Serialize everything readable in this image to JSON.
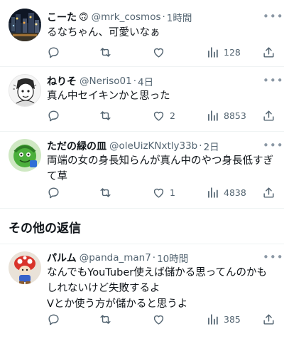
{
  "tweets": [
    {
      "name": "こーた",
      "emoji": "🙃",
      "handle": "@mrk_cosmos",
      "separator": "·",
      "time": "1時間",
      "lines": [
        "るなちゃん、可愛いなぁ"
      ],
      "likes": "",
      "views": "128",
      "avatar_icon": "night-city-avatar"
    },
    {
      "name": "ねりそ",
      "handle": "@Neriso01",
      "separator": "·",
      "time": "4日",
      "lines": [
        "真ん中セイキンかと思った"
      ],
      "likes": "2",
      "views": "8853",
      "avatar_icon": "manga-character-avatar"
    },
    {
      "name": "ただの緑の皿",
      "handle": "@oleUizKNxtly33b",
      "separator": "·",
      "time": "2日",
      "lines": [
        "両端の女の身長知らんが真ん中のやつ身長低すぎ",
        "て草"
      ],
      "likes": "1",
      "views": "4838",
      "avatar_icon": "green-character-avatar"
    }
  ],
  "section_title": "その他の返信",
  "more_tweets": [
    {
      "name": "パルム",
      "handle": "@panda_man7",
      "separator": "·",
      "time": "10時間",
      "lines": [
        "なんでもYouTuber使えば儲かる思ってんのかも",
        "しれないけど失敗するよ",
        "Vとか使う方が儲かると思うよ"
      ],
      "likes": "",
      "views": "385",
      "avatar_icon": "mushroom-figure-avatar"
    }
  ],
  "icons": {
    "more": "more-icon",
    "reply": "reply-icon",
    "retweet": "retweet-icon",
    "like": "heart-icon",
    "views": "views-icon",
    "share": "share-icon"
  },
  "colors": {
    "text": "#0f1419",
    "secondary": "#536471",
    "divider": "#eff3f4"
  }
}
